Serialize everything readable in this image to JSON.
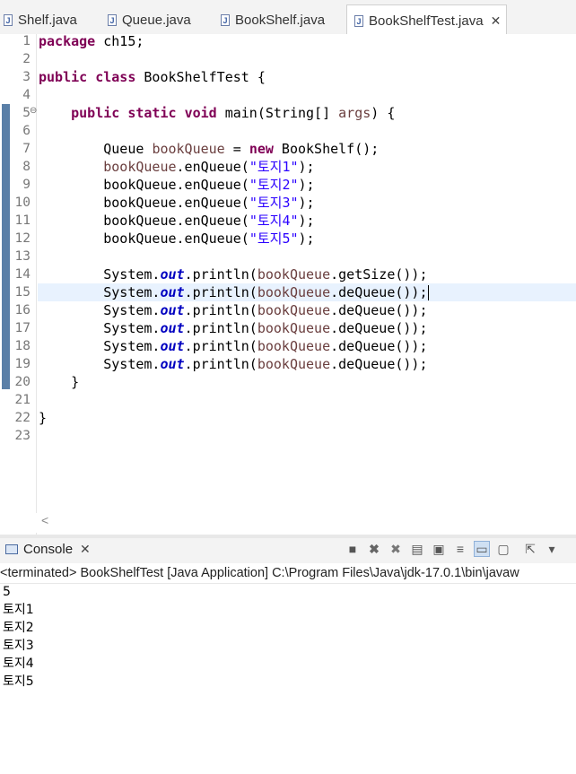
{
  "tabs": [
    {
      "label": "Shelf.java",
      "active": false
    },
    {
      "label": "Queue.java",
      "active": false
    },
    {
      "label": "BookShelf.java",
      "active": false
    },
    {
      "label": "BookShelfTest.java",
      "active": true
    }
  ],
  "editor": {
    "line_numbers": [
      "1",
      "2",
      "3",
      "4",
      "5",
      "6",
      "7",
      "8",
      "9",
      "10",
      "11",
      "12",
      "13",
      "14",
      "15",
      "16",
      "17",
      "18",
      "19",
      "20",
      "21",
      "22",
      "23"
    ],
    "line1": {
      "kw": "package",
      "rest": " ch15;"
    },
    "line3": {
      "kw1": "public",
      "kw2": "class",
      "rest": " BookShelfTest {"
    },
    "line5": {
      "kw1": "public",
      "kw2": "static",
      "kw3": "void",
      "mid": " main(String[] ",
      "param": "args",
      "end": ") {"
    },
    "line7": {
      "t1": "Queue ",
      "var": "bookQueue",
      "t2": " = ",
      "kw": "new",
      "t3": " BookShelf();"
    },
    "enqueue_lines": [
      {
        "var": "bookQueue",
        "call": ".enQueue(",
        "str": "\"토지1\"",
        "end": ");"
      },
      {
        "var": "bookQueue",
        "call": ".enQueue(",
        "str": "\"토지2\"",
        "end": ");"
      },
      {
        "var": "bookQueue",
        "call": ".enQueue(",
        "str": "\"토지3\"",
        "end": ");"
      },
      {
        "var": "bookQueue",
        "call": ".enQueue(",
        "str": "\"토지4\"",
        "end": ");"
      },
      {
        "var": "bookQueue",
        "call": ".enQueue(",
        "str": "\"토지5\"",
        "end": ");"
      }
    ],
    "print_lines": [
      {
        "sys": "System.",
        "fld": "out",
        "p": ".println(",
        "var": "bookQueue",
        "m": ".getSize());"
      },
      {
        "sys": "System.",
        "fld": "out",
        "p": ".println(",
        "var": "bookQueue",
        "m": ".deQueue());"
      },
      {
        "sys": "System.",
        "fld": "out",
        "p": ".println(",
        "var": "bookQueue",
        "m": ".deQueue());"
      },
      {
        "sys": "System.",
        "fld": "out",
        "p": ".println(",
        "var": "bookQueue",
        "m": ".deQueue());"
      },
      {
        "sys": "System.",
        "fld": "out",
        "p": ".println(",
        "var": "bookQueue",
        "m": ".deQueue());"
      },
      {
        "sys": "System.",
        "fld": "out",
        "p": ".println(",
        "var": "bookQueue",
        "m": ".deQueue());"
      }
    ],
    "close_method": "}",
    "close_class": "}"
  },
  "console": {
    "tab_label": "Console",
    "status": "<terminated> BookShelfTest [Java Application] C:\\Program Files\\Java\\jdk-17.0.1\\bin\\javaw",
    "output": [
      "5",
      "토지1",
      "토지2",
      "토지3",
      "토지4",
      "토지5"
    ]
  },
  "colors": {
    "keyword": "#7f0055",
    "string": "#2a00ff",
    "local_var": "#6a3e3e",
    "field": "#0000c0",
    "current_line": "#e8f2fe"
  }
}
